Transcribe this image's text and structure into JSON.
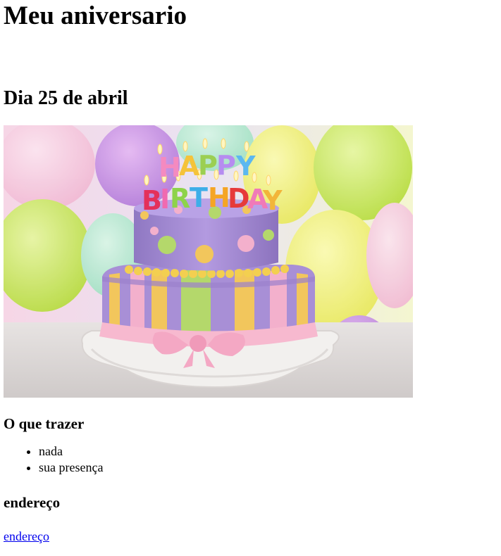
{
  "page": {
    "title": "Meu aniversario",
    "date_heading": "Dia 25 de abril"
  },
  "photo": {
    "alt": "Bolo de aniversário",
    "candles_text": [
      "HAPPY",
      "BIRTHDAY"
    ],
    "colors": {
      "cake_purple": "#a88fd6",
      "stripe_yellow": "#f2c65c",
      "stripe_green": "#b4d86b",
      "stripe_pink": "#f3b0cc",
      "ribbon_pink": "#f7b9cf",
      "board_white": "#f2f0ee"
    }
  },
  "bring_section": {
    "heading": "O que trazer",
    "items": [
      "nada",
      "sua presença"
    ]
  },
  "address_section": {
    "heading": "endereço",
    "link_label": "endereço"
  }
}
